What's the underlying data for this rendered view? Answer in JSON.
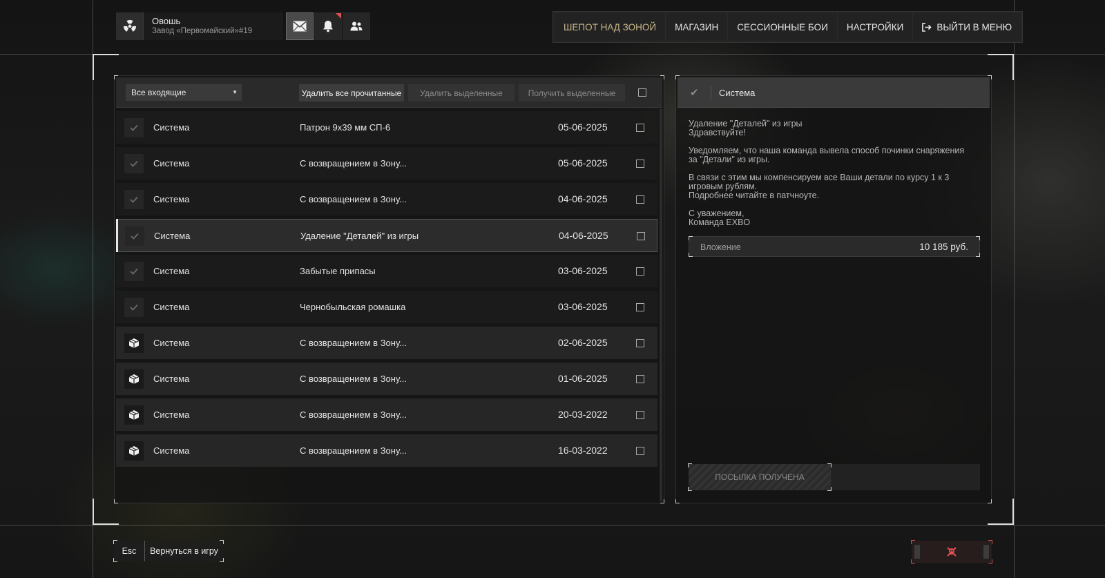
{
  "profile": {
    "nickname": "Овошь",
    "server": "Завод «Первомайский»#19"
  },
  "top_icons": [
    "mail-icon",
    "bell-icon",
    "friends-icon"
  ],
  "nav": {
    "items": [
      {
        "label": "ШЕПОТ НАД ЗОНОЙ",
        "active": true
      },
      {
        "label": "МАГАЗИН"
      },
      {
        "label": "СЕССИОННЫЕ БОИ"
      },
      {
        "label": "НАСТРОЙКИ"
      },
      {
        "label": "ВЫЙТИ В МЕНЮ"
      }
    ]
  },
  "toolbar": {
    "filter_value": "Все входящие",
    "delete_read": "Удалить все прочитанные",
    "delete_selected": "Удалить выделенные",
    "receive_selected": "Получить выделенные"
  },
  "messages": [
    {
      "sender": "Система",
      "subject": "Патрон 9х39 мм СП-6",
      "date": "05-06-2025",
      "icon": "check"
    },
    {
      "sender": "Система",
      "subject": "С возвращением в Зону...",
      "date": "05-06-2025",
      "icon": "check"
    },
    {
      "sender": "Система",
      "subject": "С возвращением в Зону...",
      "date": "04-06-2025",
      "icon": "check"
    },
    {
      "sender": "Система",
      "subject": "Удаление \"Деталей\" из игры",
      "date": "04-06-2025",
      "icon": "check",
      "selected": true
    },
    {
      "sender": "Система",
      "subject": "Забытые припасы",
      "date": "03-06-2025",
      "icon": "check"
    },
    {
      "sender": "Система",
      "subject": "Чернобыльская ромашка",
      "date": "03-06-2025",
      "icon": "check"
    },
    {
      "sender": "Система",
      "subject": "С возвращением в Зону...",
      "date": "02-06-2025",
      "icon": "box"
    },
    {
      "sender": "Система",
      "subject": "С возвращением в Зону...",
      "date": "01-06-2025",
      "icon": "box"
    },
    {
      "sender": "Система",
      "subject": "С возвращением в Зону...",
      "date": "20-03-2022",
      "icon": "box"
    },
    {
      "sender": "Система",
      "subject": "С возвращением в Зону...",
      "date": "16-03-2022",
      "icon": "box"
    }
  ],
  "detail": {
    "sender": "Система",
    "paragraphs": [
      "Удаление \"Деталей\" из игры\nЗдравствуйте!",
      "Уведомляем, что наша команда вывела способ починки снаряжения за \"Детали\" из игры.",
      "В связи с этим мы компенсируем все Ваши детали по курсу 1 к 3 игровым рублям.\nПодробнее читайте в патчноуте.",
      "С уважением,\nКоманда EXBO"
    ],
    "attachment_label": "Вложение",
    "attachment_value": "10 185 руб.",
    "received_label": "ПОСЫЛКА ПОЛУЧЕНА"
  },
  "footer": {
    "esc_key": "Esc",
    "back_label": "Вернуться в игру"
  }
}
